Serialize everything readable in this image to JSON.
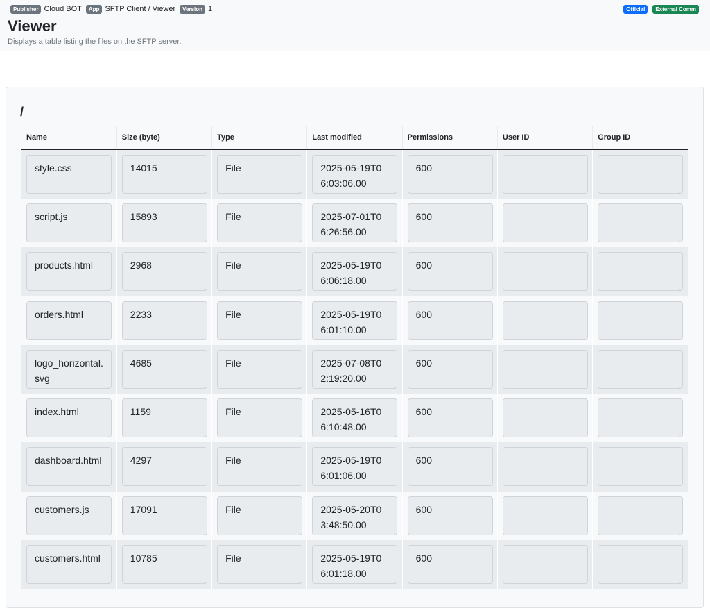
{
  "header": {
    "publisher_badge": "Publisher",
    "publisher": "Cloud BOT",
    "app_badge": "App",
    "app": "SFTP Client / Viewer",
    "version_badge": "Version",
    "version": "1",
    "official_badge": "Official",
    "external_badge": "External Comm",
    "title": "Viewer",
    "subtitle": "Displays a table listing the files on the SFTP server."
  },
  "viewer": {
    "path": "/",
    "columns": [
      "Name",
      "Size (byte)",
      "Type",
      "Last modified",
      "Permissions",
      "User ID",
      "Group ID"
    ],
    "rows": [
      {
        "name": "style.css",
        "size": "14015",
        "type": "File",
        "modified": "2025-05-19T06:03:06.00",
        "permissions": "600",
        "uid": "",
        "gid": ""
      },
      {
        "name": "script.js",
        "size": "15893",
        "type": "File",
        "modified": "2025-07-01T06:26:56.00",
        "permissions": "600",
        "uid": "",
        "gid": ""
      },
      {
        "name": "products.html",
        "size": "2968",
        "type": "File",
        "modified": "2025-05-19T06:06:18.00",
        "permissions": "600",
        "uid": "",
        "gid": ""
      },
      {
        "name": "orders.html",
        "size": "2233",
        "type": "File",
        "modified": "2025-05-19T06:01:10.00",
        "permissions": "600",
        "uid": "",
        "gid": ""
      },
      {
        "name": "logo_horizontal.svg",
        "size": "4685",
        "type": "File",
        "modified": "2025-07-08T02:19:20.00",
        "permissions": "600",
        "uid": "",
        "gid": ""
      },
      {
        "name": "index.html",
        "size": "1159",
        "type": "File",
        "modified": "2025-05-16T06:10:48.00",
        "permissions": "600",
        "uid": "",
        "gid": ""
      },
      {
        "name": "dashboard.html",
        "size": "4297",
        "type": "File",
        "modified": "2025-05-19T06:01:06.00",
        "permissions": "600",
        "uid": "",
        "gid": ""
      },
      {
        "name": "customers.js",
        "size": "17091",
        "type": "File",
        "modified": "2025-05-20T03:48:50.00",
        "permissions": "600",
        "uid": "",
        "gid": ""
      },
      {
        "name": "customers.html",
        "size": "10785",
        "type": "File",
        "modified": "2025-05-19T06:01:18.00",
        "permissions": "600",
        "uid": "",
        "gid": ""
      }
    ]
  }
}
